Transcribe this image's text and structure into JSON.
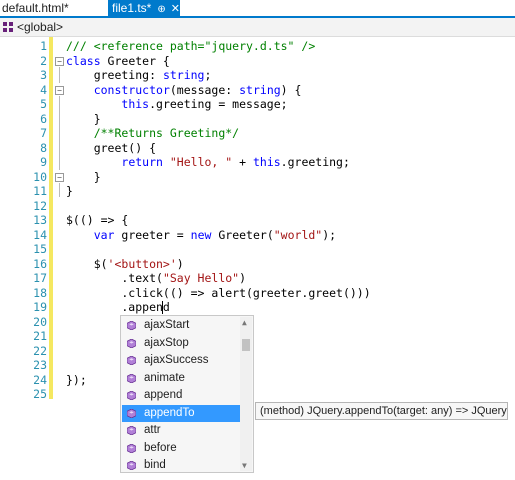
{
  "tabs": [
    {
      "label": "default.html*"
    },
    {
      "label": "file1.ts*",
      "pin_icon": "pin-icon",
      "close_icon": "close-icon"
    }
  ],
  "navbar": {
    "label": "<global>",
    "icon": "namespace-icon"
  },
  "line_numbers": [
    "1",
    "2",
    "3",
    "4",
    "5",
    "6",
    "7",
    "8",
    "9",
    "10",
    "11",
    "12",
    "13",
    "14",
    "15",
    "16",
    "17",
    "18",
    "19",
    "20",
    "21",
    "22",
    "23",
    "24",
    "25"
  ],
  "code": [
    [
      {
        "t": "/// <reference path=\"jquery.d.ts\" />",
        "c": "cm"
      }
    ],
    [
      {
        "t": "class",
        "c": "kw"
      },
      {
        "t": " Greeter {",
        "c": ""
      }
    ],
    [
      {
        "t": "    greeting: ",
        "c": ""
      },
      {
        "t": "string",
        "c": "kw"
      },
      {
        "t": ";",
        "c": ""
      }
    ],
    [
      {
        "t": "    ",
        "c": ""
      },
      {
        "t": "constructor",
        "c": "kw"
      },
      {
        "t": "(message: ",
        "c": ""
      },
      {
        "t": "string",
        "c": "kw"
      },
      {
        "t": ") {",
        "c": ""
      }
    ],
    [
      {
        "t": "        ",
        "c": ""
      },
      {
        "t": "this",
        "c": "kw"
      },
      {
        "t": ".greeting = message;",
        "c": ""
      }
    ],
    [
      {
        "t": "    }",
        "c": ""
      }
    ],
    [
      {
        "t": "    /**Returns Greeting*/",
        "c": "cm"
      }
    ],
    [
      {
        "t": "    greet() {",
        "c": ""
      }
    ],
    [
      {
        "t": "        ",
        "c": ""
      },
      {
        "t": "return",
        "c": "kw"
      },
      {
        "t": " ",
        "c": ""
      },
      {
        "t": "\"Hello, \"",
        "c": "st"
      },
      {
        "t": " + ",
        "c": ""
      },
      {
        "t": "this",
        "c": "kw"
      },
      {
        "t": ".greeting;",
        "c": ""
      }
    ],
    [
      {
        "t": "    }",
        "c": ""
      }
    ],
    [
      {
        "t": "}",
        "c": ""
      }
    ],
    [
      {
        "t": "",
        "c": ""
      }
    ],
    [
      {
        "t": "$(() => {",
        "c": ""
      }
    ],
    [
      {
        "t": "    ",
        "c": ""
      },
      {
        "t": "var",
        "c": "kw"
      },
      {
        "t": " greeter = ",
        "c": ""
      },
      {
        "t": "new",
        "c": "kw"
      },
      {
        "t": " Greeter(",
        "c": ""
      },
      {
        "t": "\"world\"",
        "c": "st"
      },
      {
        "t": ");",
        "c": ""
      }
    ],
    [
      {
        "t": "",
        "c": ""
      }
    ],
    [
      {
        "t": "    $(",
        "c": ""
      },
      {
        "t": "'<button>'",
        "c": "st"
      },
      {
        "t": ")",
        "c": ""
      }
    ],
    [
      {
        "t": "        .text(",
        "c": ""
      },
      {
        "t": "\"Say Hello\"",
        "c": "st"
      },
      {
        "t": ")",
        "c": ""
      }
    ],
    [
      {
        "t": "        .click(() => alert(greeter.greet()))",
        "c": ""
      }
    ],
    [
      {
        "t": "        .append",
        "c": ""
      }
    ],
    [
      {
        "t": "",
        "c": ""
      }
    ],
    [
      {
        "t": "",
        "c": ""
      }
    ],
    [
      {
        "t": "",
        "c": ""
      }
    ],
    [
      {
        "t": "",
        "c": ""
      }
    ],
    [
      {
        "t": "});",
        "c": ""
      }
    ],
    [
      {
        "t": "",
        "c": ""
      }
    ]
  ],
  "completion": {
    "items": [
      "ajaxStart",
      "ajaxStop",
      "ajaxSuccess",
      "animate",
      "append",
      "appendTo",
      "attr",
      "before",
      "bind"
    ],
    "selected": "appendTo",
    "item_icon": "method-icon"
  },
  "tooltip": {
    "text": "(method) JQuery.appendTo(target: any) => JQuery"
  },
  "colors": {
    "accent": "#007acc",
    "selection": "#3399ff",
    "keyword": "#0000ff",
    "comment": "#008000",
    "string": "#a31515",
    "line_number": "#2b91af",
    "change_bar": "#f5e860"
  }
}
